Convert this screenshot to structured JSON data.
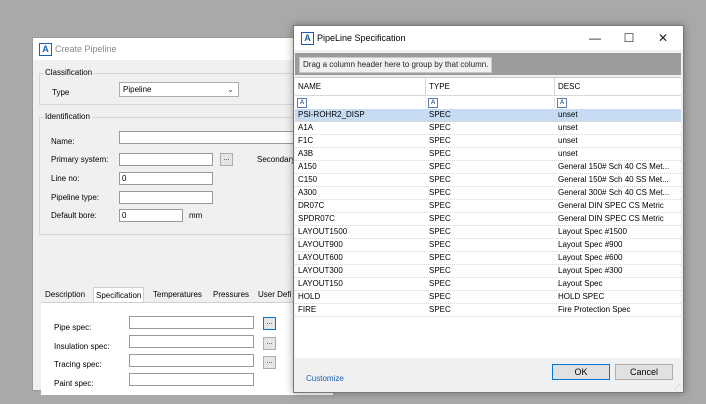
{
  "create_pipeline": {
    "title": "Create Pipeline",
    "classification": {
      "group_label": "Classification",
      "type_label": "Type",
      "type_value": "Pipeline"
    },
    "identification": {
      "group_label": "Identification",
      "name_label": "Name:",
      "primary_system_label": "Primary system:",
      "secondary_label": "Secondary",
      "line_no_label": "Line no:",
      "line_no_value": "0",
      "pipeline_type_label": "Pipeline type:",
      "default_bore_label": "Default bore:",
      "default_bore_value": "0",
      "bore_unit": "mm",
      "browse_glyph": "..."
    },
    "tabs": [
      "Description",
      "Specification",
      "Temperatures",
      "Pressures",
      "User Defi"
    ],
    "specification": {
      "pipe_spec_label": "Pipe spec:",
      "insulation_spec_label": "Insulation spec:",
      "tracing_spec_label": "Tracing spec:",
      "paint_spec_label": "Paint spec:",
      "browse_glyph": "..."
    }
  },
  "pipeline_spec": {
    "title": "PipeLine Specification",
    "window_buttons": {
      "minimize": "—",
      "maximize": "☐",
      "close": "✕"
    },
    "group_hint": "Drag a column header here to group by that column.",
    "columns": [
      "NAME",
      "TYPE",
      "DESC"
    ],
    "filter_glyph": "A",
    "selected_row": 0,
    "rows": [
      {
        "name": "PSI-ROHR2_DISP",
        "type": "SPEC",
        "desc": "unset"
      },
      {
        "name": "A1A",
        "type": "SPEC",
        "desc": "unset"
      },
      {
        "name": "F1C",
        "type": "SPEC",
        "desc": "unset"
      },
      {
        "name": "A3B",
        "type": "SPEC",
        "desc": "unset"
      },
      {
        "name": "A150",
        "type": "SPEC",
        "desc": "General 150# Sch 40 CS Met..."
      },
      {
        "name": "C150",
        "type": "SPEC",
        "desc": "General 150# Sch 40 SS Met..."
      },
      {
        "name": "A300",
        "type": "SPEC",
        "desc": "General 300# Sch 40 CS Met..."
      },
      {
        "name": "DR07C",
        "type": "SPEC",
        "desc": "General DIN SPEC CS Metric"
      },
      {
        "name": "SPDR07C",
        "type": "SPEC",
        "desc": "General DIN SPEC CS Metric"
      },
      {
        "name": "LAYOUT1500",
        "type": "SPEC",
        "desc": "Layout Spec #1500"
      },
      {
        "name": "LAYOUT900",
        "type": "SPEC",
        "desc": "Layout Spec #900"
      },
      {
        "name": "LAYOUT600",
        "type": "SPEC",
        "desc": "Layout Spec #600"
      },
      {
        "name": "LAYOUT300",
        "type": "SPEC",
        "desc": "Layout Spec #300"
      },
      {
        "name": "LAYOUT150",
        "type": "SPEC",
        "desc": "Layout Spec"
      },
      {
        "name": "HOLD",
        "type": "SPEC",
        "desc": "HOLD SPEC"
      },
      {
        "name": "FIRE",
        "type": "SPEC",
        "desc": "Fire Protection Spec"
      }
    ],
    "customize_label": "Customize",
    "ok_label": "OK",
    "cancel_label": "Cancel"
  },
  "icon_glyph": "A"
}
